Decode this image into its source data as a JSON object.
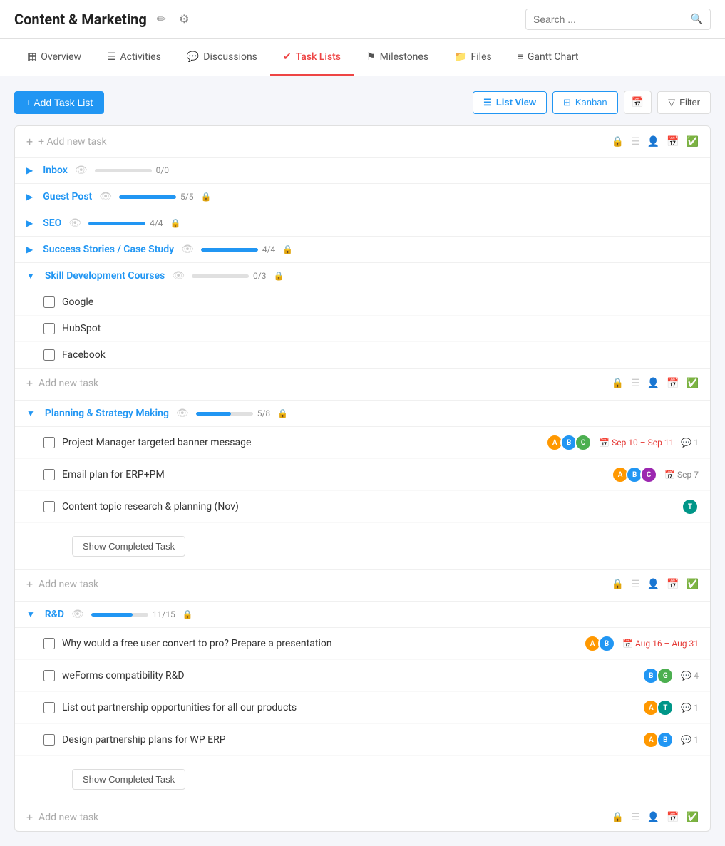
{
  "header": {
    "title": "Content & Marketing",
    "edit_icon": "✏",
    "settings_icon": "⚙",
    "search_placeholder": "Search ..."
  },
  "tabs": [
    {
      "id": "overview",
      "label": "Overview",
      "icon": "▦",
      "active": false
    },
    {
      "id": "activities",
      "label": "Activities",
      "icon": "☰",
      "active": false
    },
    {
      "id": "discussions",
      "label": "Discussions",
      "icon": "💬",
      "active": false
    },
    {
      "id": "task-lists",
      "label": "Task Lists",
      "icon": "✔",
      "active": true
    },
    {
      "id": "milestones",
      "label": "Milestones",
      "icon": "⚑",
      "active": false
    },
    {
      "id": "files",
      "label": "Files",
      "icon": "📁",
      "active": false
    },
    {
      "id": "gantt-chart",
      "label": "Gantt Chart",
      "icon": "≡",
      "active": false
    }
  ],
  "toolbar": {
    "add_tasklist_label": "+ Add Task List",
    "list_view_label": "List View",
    "kanban_label": "Kanban",
    "filter_label": "Filter"
  },
  "add_new_task_placeholder": "+ Add new task",
  "task_lists": [
    {
      "id": "inbox",
      "name": "Inbox",
      "expanded": false,
      "progress": 0,
      "total": 0,
      "progress_pct": 0,
      "show_lock": false,
      "tasks": []
    },
    {
      "id": "guest-post",
      "name": "Guest Post",
      "expanded": false,
      "progress": 5,
      "total": 5,
      "progress_pct": 100,
      "show_lock": true,
      "tasks": []
    },
    {
      "id": "seo",
      "name": "SEO",
      "expanded": false,
      "progress": 4,
      "total": 4,
      "progress_pct": 100,
      "show_lock": true,
      "tasks": []
    },
    {
      "id": "success-stories",
      "name": "Success Stories / Case Study",
      "expanded": false,
      "progress": 4,
      "total": 4,
      "progress_pct": 100,
      "show_lock": true,
      "tasks": []
    },
    {
      "id": "skill-dev",
      "name": "Skill Development Courses",
      "expanded": true,
      "progress": 0,
      "total": 3,
      "progress_pct": 0,
      "show_lock": true,
      "tasks": [
        {
          "name": "Google",
          "avatars": [],
          "date": null,
          "comments": null
        },
        {
          "name": "HubSpot",
          "avatars": [],
          "date": null,
          "comments": null
        },
        {
          "name": "Facebook",
          "avatars": [],
          "date": null,
          "comments": null
        }
      ],
      "show_completed": false
    },
    {
      "id": "planning",
      "name": "Planning & Strategy Making",
      "expanded": true,
      "progress": 5,
      "total": 8,
      "progress_pct": 62,
      "show_lock": true,
      "tasks": [
        {
          "name": "Project Manager targeted banner message",
          "avatars": [
            "av-orange",
            "av-blue",
            "av-green"
          ],
          "date": "Sep 10 – Sep 11",
          "date_color": "red",
          "comments": 1
        },
        {
          "name": "Email plan for ERP+PM",
          "avatars": [
            "av-orange",
            "av-blue",
            "av-purple"
          ],
          "date": "Sep 7",
          "date_color": "gray",
          "comments": null
        },
        {
          "name": "Content topic research & planning (Nov)",
          "avatars": [
            "av-teal"
          ],
          "date": null,
          "date_color": null,
          "comments": null
        }
      ],
      "show_completed": true,
      "show_completed_label": "Show Completed Task"
    },
    {
      "id": "rnd",
      "name": "R&D",
      "expanded": true,
      "progress": 11,
      "total": 15,
      "progress_pct": 73,
      "show_lock": true,
      "tasks": [
        {
          "name": "Why would a free user convert to pro? Prepare a presentation",
          "avatars": [
            "av-orange",
            "av-blue"
          ],
          "date": "Aug 16 – Aug 31",
          "date_color": "red",
          "comments": null
        },
        {
          "name": "weForms compatibility R&D",
          "avatars": [
            "av-blue",
            "av-green"
          ],
          "date": null,
          "date_color": null,
          "comments": 4
        },
        {
          "name": "List out partnership opportunities for all our products",
          "avatars": [
            "av-orange",
            "av-teal"
          ],
          "date": null,
          "date_color": null,
          "comments": 1
        },
        {
          "name": "Design partnership plans for WP ERP",
          "avatars": [
            "av-orange",
            "av-blue"
          ],
          "date": null,
          "date_color": null,
          "comments": 1
        }
      ],
      "show_completed": true,
      "show_completed_label": "Show Completed Task"
    }
  ]
}
